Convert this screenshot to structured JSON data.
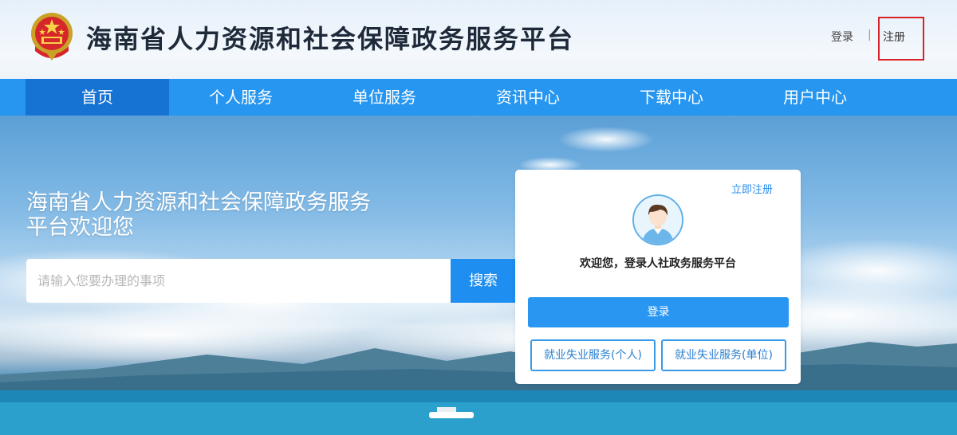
{
  "header": {
    "title": "海南省人力资源和社会保障政务服务平台",
    "login_link": "登录",
    "separator": "|",
    "register_link": "注册"
  },
  "nav": {
    "items": [
      {
        "label": "首页",
        "active": true
      },
      {
        "label": "个人服务"
      },
      {
        "label": "单位服务"
      },
      {
        "label": "资讯中心"
      },
      {
        "label": "下载中心"
      },
      {
        "label": "用户中心"
      }
    ]
  },
  "hero": {
    "title": "海南省人力资源和社会保障政务服务平台欢迎您",
    "search_placeholder": "请输入您要办理的事项",
    "search_value": "",
    "search_button": "搜索"
  },
  "login_card": {
    "register_now": "立即注册",
    "welcome": "欢迎您，登录人社政务服务平台",
    "login_button": "登录",
    "personal_button": "就业失业服务(个人)",
    "unit_button": "就业失业服务(单位)",
    "avatar_icon": "user-avatar-icon"
  },
  "colors": {
    "nav_bg": "#2696f0",
    "nav_active": "#1673d4",
    "primary": "#2996f2",
    "highlight_border": "#d9232a"
  }
}
